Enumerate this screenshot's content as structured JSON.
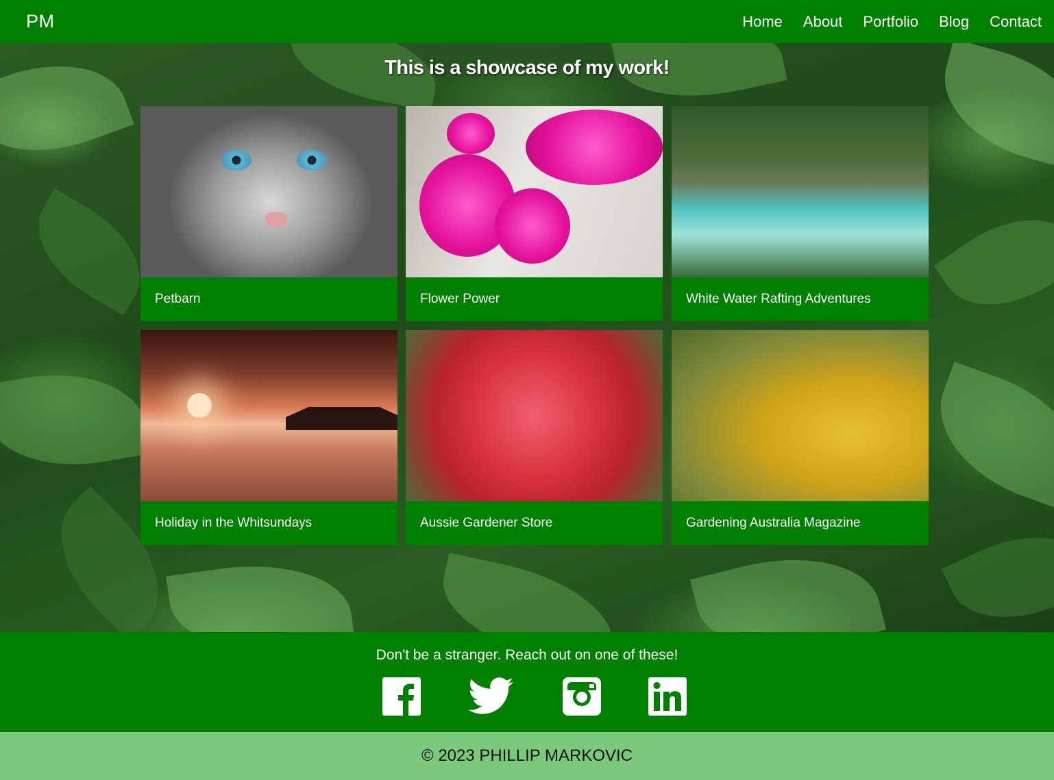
{
  "header": {
    "brand": "PM",
    "nav": [
      "Home",
      "About",
      "Portfolio",
      "Blog",
      "Contact"
    ]
  },
  "main": {
    "title": "This is a showcase of my work!",
    "projects": [
      {
        "title": "Petbarn",
        "image": "cat-photo"
      },
      {
        "title": "Flower Power",
        "image": "bougainvillea-photo"
      },
      {
        "title": "White Water Rafting Adventures",
        "image": "river-photo"
      },
      {
        "title": "Holiday in the Whitsundays",
        "image": "sunset-photo"
      },
      {
        "title": "Aussie Gardener Store",
        "image": "grevillea-photo"
      },
      {
        "title": "Gardening Australia Magazine",
        "image": "kangaroo-paw-photo"
      }
    ]
  },
  "footer": {
    "message": "Don't be a stranger. Reach out on one of these!",
    "socials": [
      "facebook-icon",
      "twitter-icon",
      "instagram-icon",
      "linkedin-icon"
    ],
    "copyright": "© 2023 PHILLIP MARKOVIC"
  },
  "colors": {
    "primary": "#008000",
    "copyright_bar": "#7bc97b"
  }
}
